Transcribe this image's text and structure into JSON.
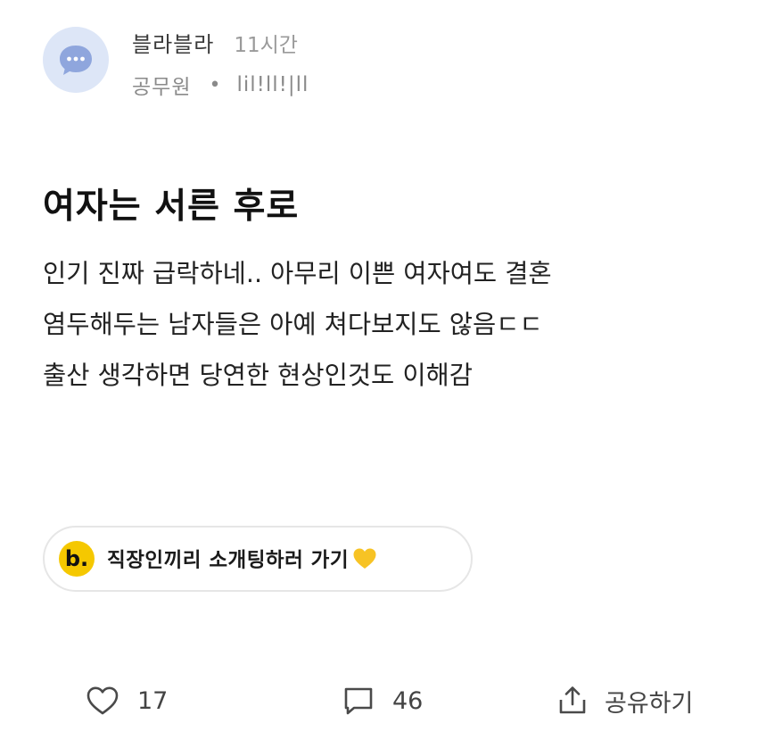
{
  "post": {
    "author": "블라블라",
    "time": "11시간",
    "job": "공무원",
    "separator": "•",
    "company": "lil!ll!|ll",
    "title": "여자는 서른 후로",
    "body_lines": [
      "인기 진짜 급락하네.. 아무리 이쁜 여자여도 결혼",
      "염두해두는 남자들은 아예 쳐다보지도 않음ㄷㄷ",
      "출산 생각하면 당연한 현상인것도 이해감"
    ]
  },
  "ad": {
    "logo_letter": "b.",
    "text": "직장인끼리 소개팅하러 가기",
    "heart_icon": "yellow-heart-icon"
  },
  "actions": {
    "likes": "17",
    "comments": "46",
    "share_label": "공유하기"
  },
  "colors": {
    "avatar_bg": "#dde6f7",
    "avatar_bubble": "#8fa6dd",
    "ad_logo": "#f5c800",
    "heart": "#f7c325"
  }
}
